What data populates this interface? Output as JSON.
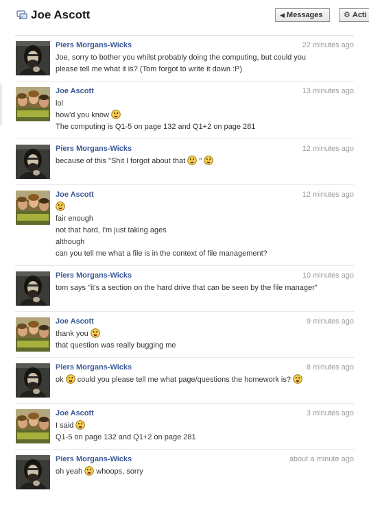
{
  "header": {
    "title": "Joe Ascott",
    "messages_button": "Messages",
    "actions_button": "Acti"
  },
  "messages": [
    {
      "sender": "Piers Morgans-Wicks",
      "time": "22 minutes ago",
      "lines": [
        [
          {
            "t": "text",
            "v": "Joe, sorry to bother you whilst probably doing the computing, but could you please tell me what it is? (Tom forgot to write it down :P)"
          }
        ]
      ]
    },
    {
      "sender": "Joe Ascott",
      "time": "13 minutes ago",
      "lines": [
        [
          {
            "t": "text",
            "v": "lol"
          }
        ],
        [
          {
            "t": "text",
            "v": "how'd you know "
          },
          {
            "t": "emoji",
            "v": "smiley-icon"
          }
        ],
        [
          {
            "t": "text",
            "v": "The computing is Q1-5 on page 132 and Q1+2 on page 281"
          }
        ]
      ]
    },
    {
      "sender": "Piers Morgans-Wicks",
      "time": "12 minutes ago",
      "lines": [
        [
          {
            "t": "text",
            "v": "because of this \"Shit I forgot about that "
          },
          {
            "t": "emoji",
            "v": "smiley-icon"
          },
          {
            "t": "text",
            "v": " \" "
          },
          {
            "t": "emoji",
            "v": "smiley-icon"
          }
        ]
      ]
    },
    {
      "sender": "Joe Ascott",
      "time": "12 minutes ago",
      "lines": [
        [
          {
            "t": "emoji",
            "v": "smiley-icon"
          }
        ],
        [
          {
            "t": "text",
            "v": "fair enough"
          }
        ],
        [
          {
            "t": "text",
            "v": "not that hard, I'm just taking ages"
          }
        ],
        [
          {
            "t": "text",
            "v": "although"
          }
        ],
        [
          {
            "t": "text",
            "v": "can you tell me what a file is in the context of file management?"
          }
        ]
      ]
    },
    {
      "sender": "Piers Morgans-Wicks",
      "time": "10 minutes ago",
      "lines": [
        [
          {
            "t": "text",
            "v": "tom says \"it's a section on the hard drive that can be seen by the file manager\""
          }
        ]
      ]
    },
    {
      "sender": "Joe Ascott",
      "time": "9 minutes ago",
      "lines": [
        [
          {
            "t": "text",
            "v": "thank you "
          },
          {
            "t": "emoji",
            "v": "smiley-icon"
          }
        ],
        [
          {
            "t": "text",
            "v": "that question was really bugging me"
          }
        ]
      ]
    },
    {
      "sender": "Piers Morgans-Wicks",
      "time": "8 minutes ago",
      "lines": [
        [
          {
            "t": "text",
            "v": "ok "
          },
          {
            "t": "emoji",
            "v": "smiley-icon"
          },
          {
            "t": "text",
            "v": " could you please tell me what page/questions the homework is? "
          },
          {
            "t": "emoji",
            "v": "smiley-icon"
          }
        ]
      ]
    },
    {
      "sender": "Joe Ascott",
      "time": "3 minutes ago",
      "lines": [
        [
          {
            "t": "text",
            "v": "I said "
          },
          {
            "t": "emoji",
            "v": "smiley-icon"
          }
        ],
        [
          {
            "t": "text",
            "v": "Q1-5 on page 132 and Q1+2 on page 281"
          }
        ]
      ]
    },
    {
      "sender": "Piers Morgans-Wicks",
      "time": "about a minute ago",
      "lines": [
        [
          {
            "t": "text",
            "v": "oh yeah "
          },
          {
            "t": "emoji",
            "v": "smiley-icon"
          },
          {
            "t": "text",
            "v": " whoops, sorry"
          }
        ]
      ]
    }
  ],
  "colors": {
    "link": "#3b5998",
    "timestamp": "#999999",
    "divider": "#e9e9e9",
    "emoji_fill": "#f7d24b"
  }
}
